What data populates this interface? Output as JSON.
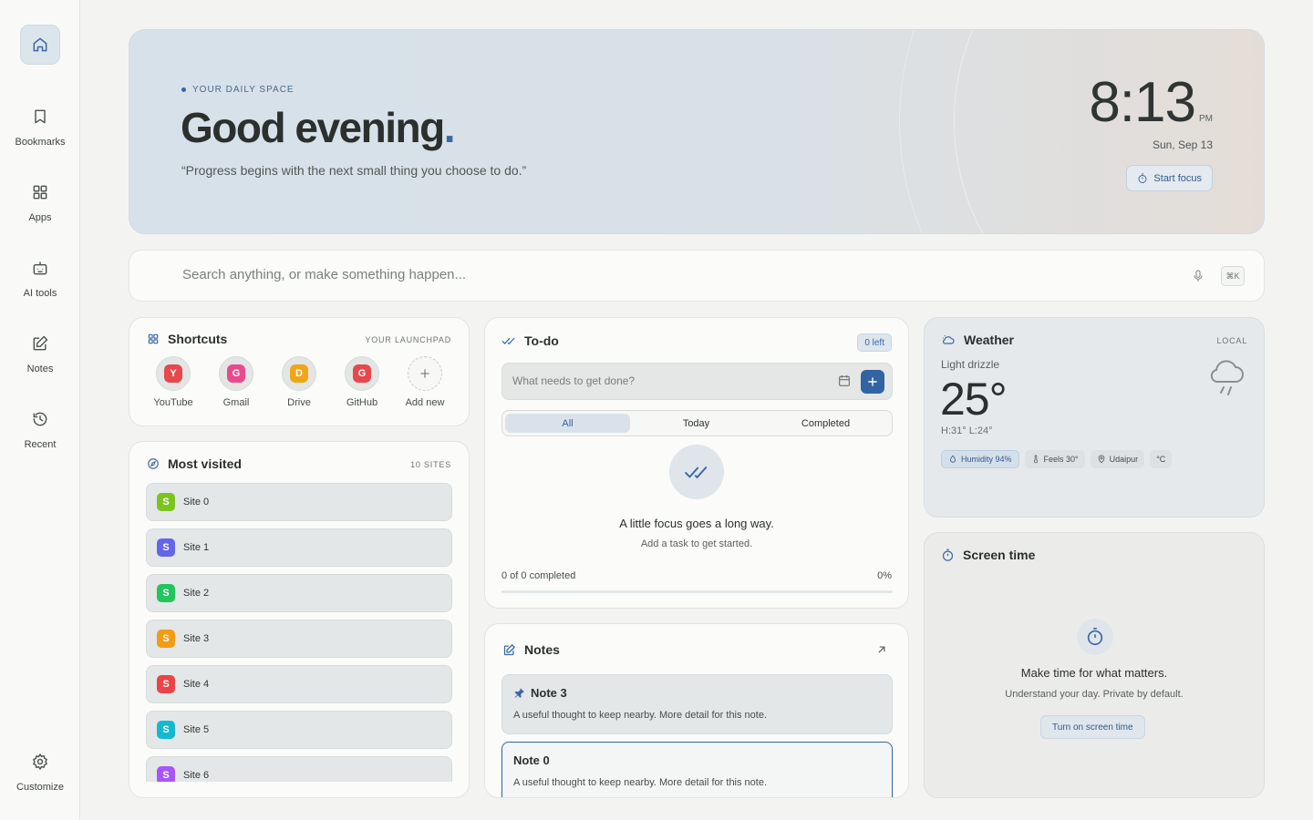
{
  "sidebar": {
    "items": [
      {
        "label": "Bookmarks",
        "icon": "bookmark-icon"
      },
      {
        "label": "Apps",
        "icon": "grid-icon"
      },
      {
        "label": "AI tools",
        "icon": "robot-icon"
      },
      {
        "label": "Notes",
        "icon": "edit-icon"
      },
      {
        "label": "Recent",
        "icon": "history-icon"
      }
    ],
    "customize_label": "Customize"
  },
  "hero": {
    "eyebrow": "YOUR DAILY SPACE",
    "greeting": "Good evening",
    "greeting_accent": ".",
    "quote": "“Progress begins with the next small thing you choose to do.”",
    "time": "8:13",
    "ampm": "PM",
    "date": "Sun, Sep 13",
    "focus_label": "Start focus"
  },
  "search": {
    "placeholder": "Search anything, or make something happen...",
    "shortcut": "⌘K"
  },
  "shortcuts": {
    "title": "Shortcuts",
    "tag": "YOUR LAUNCHPAD",
    "items": [
      {
        "name": "YouTube",
        "letter": "Y",
        "color": "#e5484d"
      },
      {
        "name": "Gmail",
        "letter": "G",
        "color": "#e84a8f"
      },
      {
        "name": "Drive",
        "letter": "D",
        "color": "#f0a516"
      },
      {
        "name": "GitHub",
        "letter": "G",
        "color": "#e5484d"
      }
    ],
    "add_label": "Add new"
  },
  "most_visited": {
    "title": "Most visited",
    "tag": "10 SITES",
    "sites": [
      {
        "name": "Site 0",
        "letter": "S",
        "color": "#7ac421"
      },
      {
        "name": "Site 1",
        "letter": "S",
        "color": "#6366e8"
      },
      {
        "name": "Site 2",
        "letter": "S",
        "color": "#22c55e"
      },
      {
        "name": "Site 3",
        "letter": "S",
        "color": "#f29b14"
      },
      {
        "name": "Site 4",
        "letter": "S",
        "color": "#ea4449"
      },
      {
        "name": "Site 5",
        "letter": "S",
        "color": "#14b8d0"
      },
      {
        "name": "Site 6",
        "letter": "S",
        "color": "#a855f7"
      }
    ]
  },
  "todo": {
    "title": "To-do",
    "badge": "0 left",
    "placeholder": "What needs to get done?",
    "tabs": [
      "All",
      "Today",
      "Completed"
    ],
    "active_tab": "All",
    "empty_title": "A little focus goes a long way.",
    "empty_sub": "Add a task to get started.",
    "progress_text": "0 of 0 completed",
    "progress_pct": "0%",
    "progress_value": 0
  },
  "notes": {
    "title": "Notes",
    "items": [
      {
        "title": "Note 3",
        "body": "A useful thought to keep nearby. More detail for this note.",
        "pinned": true
      },
      {
        "title": "Note 0",
        "body": "A useful thought to keep nearby. More detail for this note.",
        "pinned": false
      }
    ]
  },
  "weather": {
    "title": "Weather",
    "tag": "LOCAL",
    "condition": "Light drizzle",
    "temp": "25°",
    "hilo": "H:31° L:24°",
    "humidity": "Humidity 94%",
    "feels": "Feels 30°",
    "location": "Udaipur",
    "unit": "°C"
  },
  "screen_time": {
    "title": "Screen time",
    "headline": "Make time for what matters.",
    "sub": "Understand your day. Private by default.",
    "button": "Turn on screen time"
  },
  "colors": {
    "accent": "#3263a3"
  }
}
